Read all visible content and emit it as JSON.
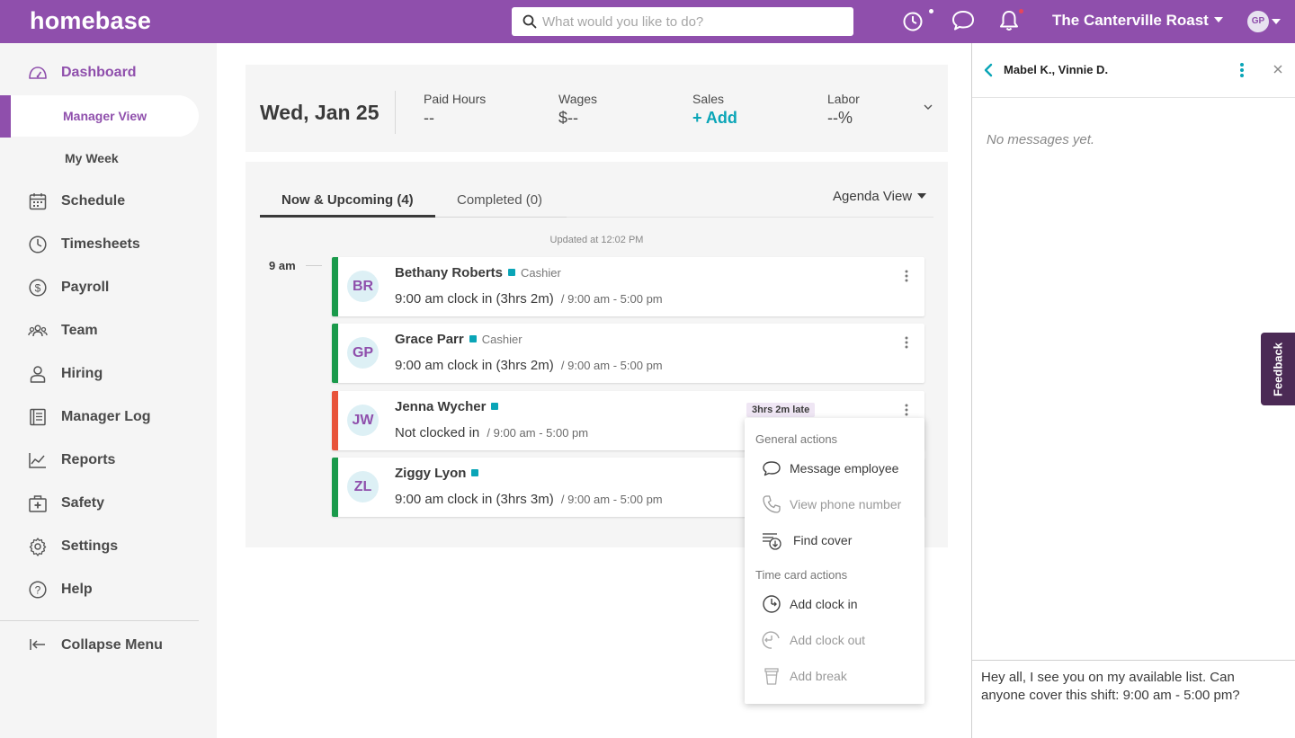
{
  "app": {
    "logo": "homebase"
  },
  "topbar": {
    "search_placeholder": "What would you like to do?",
    "store_name": "The Canterville Roast",
    "user_initials": "GP",
    "notification_dot_color": "#e8465a",
    "timeclock_dot_color": "#ffffff"
  },
  "sidebar": {
    "dashboard": "Dashboard",
    "manager_view": "Manager View",
    "my_week": "My Week",
    "schedule": "Schedule",
    "timesheets": "Timesheets",
    "payroll": "Payroll",
    "team": "Team",
    "hiring": "Hiring",
    "manager_log": "Manager Log",
    "reports": "Reports",
    "safety": "Safety",
    "settings": "Settings",
    "help": "Help",
    "collapse": "Collapse Menu"
  },
  "summary": {
    "date": "Wed, Jan 25",
    "paid_hours_label": "Paid Hours",
    "paid_hours_value": "--",
    "wages_label": "Wages",
    "wages_value": "$--",
    "sales_label": "Sales",
    "sales_value": "+ Add",
    "labor_label": "Labor",
    "labor_value": "--%"
  },
  "agenda": {
    "tab_upcoming": "Now & Upcoming (4)",
    "tab_completed": "Completed (0)",
    "view_label": "Agenda View",
    "updated": "Updated at 12:02 PM",
    "time_label": "9 am",
    "shifts": [
      {
        "initials": "BR",
        "name": "Bethany Roberts",
        "role": "Cashier",
        "status": "9:00 am clock in (3hrs 2m)",
        "hours": "/ 9:00 am - 5:00 pm",
        "stripe": "#1a9a4b"
      },
      {
        "initials": "GP",
        "name": "Grace Parr",
        "role": "Cashier",
        "status": "9:00 am clock in (3hrs 2m)",
        "hours": "/ 9:00 am - 5:00 pm",
        "stripe": "#1a9a4b"
      },
      {
        "initials": "JW",
        "name": "Jenna Wycher",
        "role": "",
        "status": "Not clocked in",
        "hours": "/ 9:00 am - 5:00 pm",
        "stripe": "#e8533a",
        "badge": "3hrs 2m late"
      },
      {
        "initials": "ZL",
        "name": "Ziggy Lyon",
        "role": "",
        "status": "9:00 am clock in (3hrs 3m)",
        "hours": "/ 9:00 am - 5:00 pm",
        "stripe": "#1a9a4b"
      }
    ]
  },
  "menu": {
    "general_heading": "General actions",
    "message_employee": "Message employee",
    "view_phone": "View phone number",
    "find_cover": "Find cover",
    "timecard_heading": "Time card actions",
    "add_clock_in": "Add clock in",
    "add_clock_out": "Add clock out",
    "add_break": "Add break"
  },
  "chat": {
    "title": "Mabel K., Vinnie D.",
    "empty": "No messages yet.",
    "draft": "Hey all, I see you on my available list. Can anyone cover this shift: 9:00 am - 5:00 pm?"
  },
  "feedback": "Feedback",
  "colors": {
    "brand": "#8f4fac",
    "accent": "#0aa5b7"
  }
}
